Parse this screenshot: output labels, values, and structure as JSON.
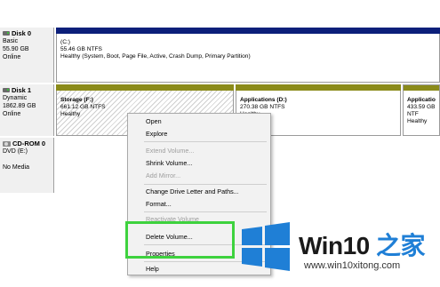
{
  "disks": [
    {
      "name": "Disk 0",
      "lines": [
        "Basic",
        "55.90 GB",
        "Online"
      ],
      "partitions": [
        {
          "title": "(C:)",
          "lines": [
            "55.46 GB NTFS",
            "Healthy (System, Boot, Page File, Active, Crash Dump, Primary Partition)"
          ]
        }
      ]
    },
    {
      "name": "Disk 1",
      "lines": [
        "Dynamic",
        "1862.89 GB",
        "Online"
      ],
      "partitions": [
        {
          "title": "Storage  (F:)",
          "lines": [
            "661.12 GB NTFS",
            "Healthy"
          ]
        },
        {
          "title": "Applications  (D:)",
          "lines": [
            "270.38 GB NTFS",
            "Healthy"
          ]
        },
        {
          "title": "Applicatio",
          "lines": [
            "433.59 GB NTF",
            "Healthy"
          ]
        }
      ]
    },
    {
      "name": "CD-ROM 0",
      "lines": [
        "DVD (E:)",
        "",
        "No Media"
      ]
    }
  ],
  "context_menu": {
    "items": [
      {
        "label": "Open",
        "enabled": true
      },
      {
        "label": "Explore",
        "enabled": true
      },
      {
        "label": "Extend Volume...",
        "enabled": false
      },
      {
        "label": "Shrink Volume...",
        "enabled": true
      },
      {
        "label": "Add Mirror...",
        "enabled": false
      },
      {
        "label": "Change Drive Letter and Paths...",
        "enabled": true
      },
      {
        "label": "Format...",
        "enabled": true
      },
      {
        "label": "Reactivate Volume",
        "enabled": false
      },
      {
        "label": "Delete Volume...",
        "enabled": true,
        "highlighted": true
      },
      {
        "label": "Properties",
        "enabled": true
      },
      {
        "label": "Help",
        "enabled": true
      }
    ]
  },
  "watermark": {
    "brand_prefix": "Win10",
    "brand_suffix": " 之家",
    "url": "www.win10xitong.com"
  },
  "colors": {
    "primary_bar": "#0c1f7a",
    "dynamic_bar": "#8b8b1a",
    "highlight_box": "#3ed23e",
    "windows_blue": "#1f7fd6"
  }
}
